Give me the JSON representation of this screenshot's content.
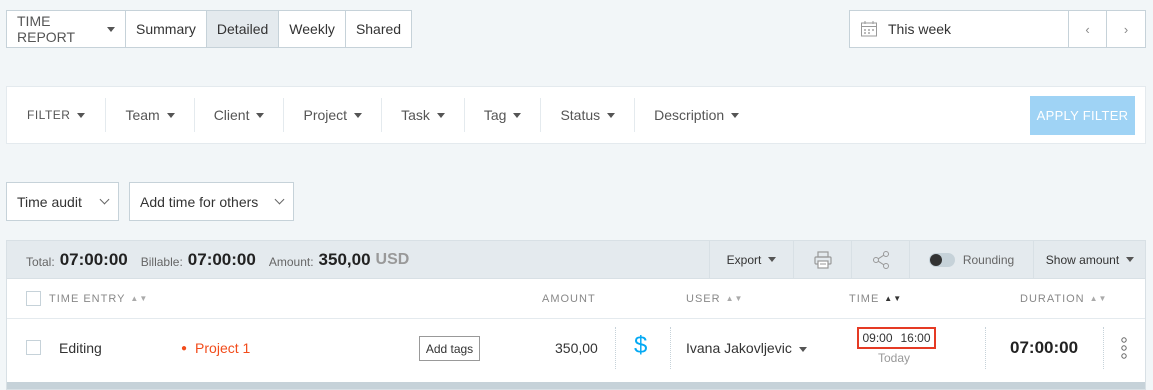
{
  "header": {
    "report_type": "TIME REPORT",
    "tabs": [
      "Summary",
      "Detailed",
      "Weekly",
      "Shared"
    ],
    "active_tab": "Detailed",
    "date_range": "This week",
    "prev_icon": "‹",
    "next_icon": "›"
  },
  "filters": {
    "label": "FILTER",
    "items": [
      "Team",
      "Client",
      "Project",
      "Task",
      "Tag",
      "Status",
      "Description"
    ],
    "apply_label": "APPLY FILTER"
  },
  "controls": {
    "time_audit": "Time audit",
    "add_time": "Add time for others"
  },
  "totals": {
    "total_label": "Total:",
    "total_value": "07:00:00",
    "billable_label": "Billable:",
    "billable_value": "07:00:00",
    "amount_label": "Amount:",
    "amount_value": "350,00",
    "currency": "USD",
    "export_label": "Export",
    "rounding_label": "Rounding",
    "show_amount_label": "Show amount"
  },
  "table": {
    "columns": {
      "entry": "TIME ENTRY",
      "amount": "AMOUNT",
      "user": "USER",
      "time": "TIME",
      "duration": "DURATION"
    },
    "rows": [
      {
        "description": "Editing",
        "project": "Project 1",
        "project_color": "#f24c1b",
        "tags_label": "Add tags",
        "amount": "350,00",
        "billable_symbol": "$",
        "user": "Ivana Jakovljevic",
        "start": "09:00",
        "end": "16:00",
        "day": "Today",
        "duration": "07:00:00"
      }
    ]
  },
  "colors": {
    "accent": "#03a9f4",
    "apply_disabled": "#9fd3f5",
    "highlight": "#e53a24"
  }
}
